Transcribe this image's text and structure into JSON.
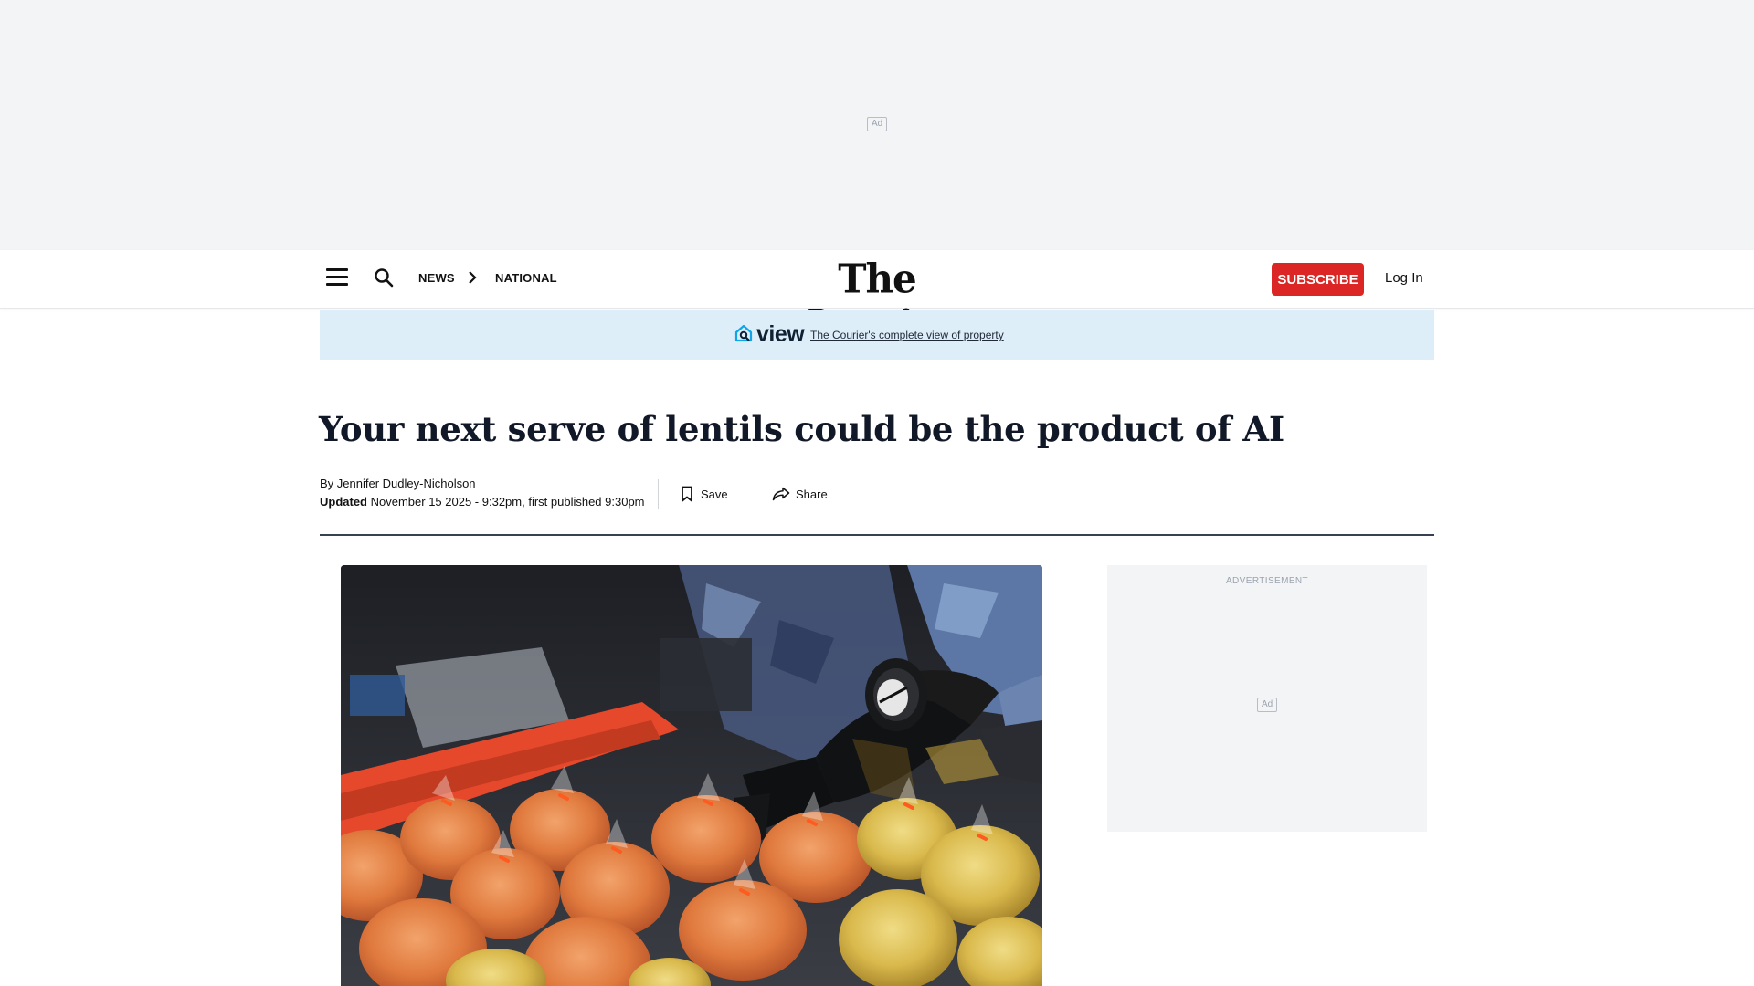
{
  "top_ad": {
    "badge": "Ad"
  },
  "header": {
    "breadcrumb": [
      "NEWS",
      "NATIONAL"
    ],
    "logo": "The Courier",
    "subscribe": "SUBSCRIBE",
    "login": "Log In"
  },
  "view_banner": {
    "logo_text": "view",
    "link": "The Courier's complete view of property"
  },
  "article": {
    "headline": "Your next serve of lentils could be the product of AI",
    "byline_prefix": "By",
    "author": "Jennifer Dudley-Nicholson",
    "updated_label": "Updated",
    "date": "November 15 2025 - 9:32pm, first published 9:30pm",
    "save": "Save",
    "share": "Share"
  },
  "side_ad": {
    "label": "ADVERTISEMENT",
    "badge": "Ad"
  },
  "icons": {
    "menu": "hamburger-icon",
    "search": "search-icon",
    "breadcrumb_sep": "chevron-right-icon",
    "save": "bookmark-icon",
    "share": "share-arrow-icon",
    "view_logo": "house-magnifier-icon"
  },
  "colors": {
    "subscribe_bg": "#dc2626",
    "banner_bg": "#deeef9",
    "ad_bg": "#f3f4f6",
    "view_logo_accent": "#0ea5e9"
  }
}
